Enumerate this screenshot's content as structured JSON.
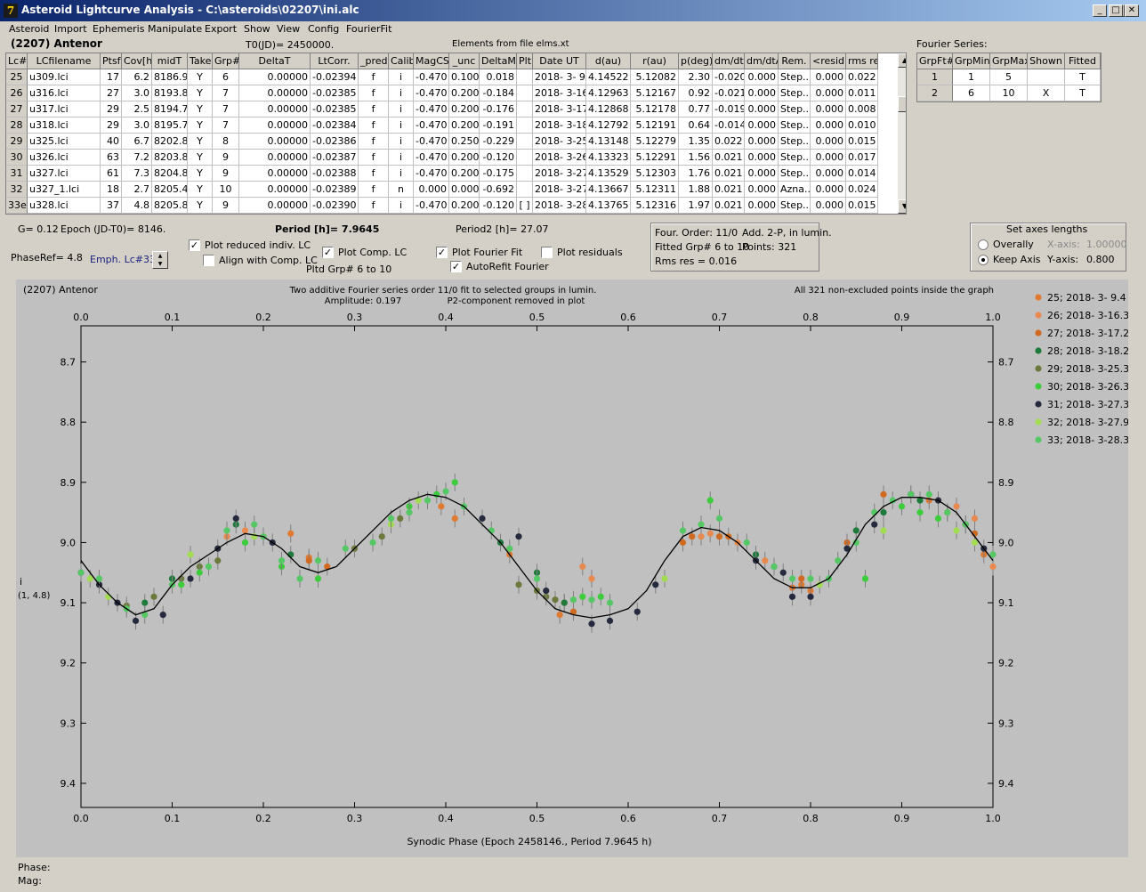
{
  "window": {
    "title": "Asteroid Lightcurve Analysis - C:\\asteroids\\02207\\ini.alc",
    "icon": "7"
  },
  "menu": [
    "Asteroid",
    "Import",
    "Ephemeris",
    "Manipulate",
    "Export",
    "Show",
    "View",
    "Config",
    "FourierFit"
  ],
  "header": {
    "asteroid": "(2207) Antenor",
    "t0": "T0(JD)= 2450000.",
    "elements": "Elements from file elms.xt",
    "fourier_series_label": "Fourier Series:"
  },
  "table": {
    "columns": [
      "Lc#",
      "LCfilename",
      "Ptsf",
      "Cov[h]",
      "midT",
      "Take",
      "Grp#",
      "DeltaT",
      "LtCorr.",
      "_pred.",
      "Calib.",
      "MagCS",
      "_unc",
      "DeltaM",
      "Plt",
      "Date UT",
      "d(au)",
      "r(au)",
      "p(deg)",
      "dm/dt",
      "dm/dtA",
      "Rem.",
      "<resid>",
      "rms res"
    ],
    "rows": [
      [
        "25",
        "u309.lci",
        "17",
        "6.2",
        "8186.9",
        "Y",
        "6",
        "0.00000",
        "-0.02394",
        "f",
        "i",
        "-0.470",
        "0.100",
        "0.018",
        "",
        "2018- 3- 9.4",
        "4.14522",
        "5.12082",
        "2.30",
        "-0.020",
        "0.000",
        "Step...",
        "0.000",
        "0.022"
      ],
      [
        "26",
        "u316.lci",
        "27",
        "3.0",
        "8193.8",
        "Y",
        "7",
        "0.00000",
        "-0.02385",
        "f",
        "i",
        "-0.470",
        "0.200",
        "-0.184",
        "",
        "2018- 3-16.3",
        "4.12963",
        "5.12167",
        "0.92",
        "-0.021",
        "0.000",
        "Step...",
        "0.000",
        "0.011"
      ],
      [
        "27",
        "u317.lci",
        "29",
        "2.5",
        "8194.7",
        "Y",
        "7",
        "0.00000",
        "-0.02385",
        "f",
        "i",
        "-0.470",
        "0.200",
        "-0.176",
        "",
        "2018- 3-17.2",
        "4.12868",
        "5.12178",
        "0.77",
        "-0.019",
        "0.000",
        "Step...",
        "0.000",
        "0.008"
      ],
      [
        "28",
        "u318.lci",
        "29",
        "3.0",
        "8195.7",
        "Y",
        "7",
        "0.00000",
        "-0.02384",
        "f",
        "i",
        "-0.470",
        "0.200",
        "-0.191",
        "",
        "2018- 3-18.2",
        "4.12792",
        "5.12191",
        "0.64",
        "-0.014",
        "0.000",
        "Step...",
        "0.000",
        "0.010"
      ],
      [
        "29",
        "u325.lci",
        "40",
        "6.7",
        "8202.8",
        "Y",
        "8",
        "0.00000",
        "-0.02386",
        "f",
        "i",
        "-0.470",
        "0.250",
        "-0.229",
        "",
        "2018- 3-25.3",
        "4.13148",
        "5.12279",
        "1.35",
        "0.022",
        "0.000",
        "Step...",
        "0.000",
        "0.015"
      ],
      [
        "30",
        "u326.lci",
        "63",
        "7.2",
        "8203.8",
        "Y",
        "9",
        "0.00000",
        "-0.02387",
        "f",
        "i",
        "-0.470",
        "0.200",
        "-0.120",
        "",
        "2018- 3-26.3",
        "4.13323",
        "5.12291",
        "1.56",
        "0.021",
        "0.000",
        "Step...",
        "0.000",
        "0.017"
      ],
      [
        "31",
        "u327.lci",
        "61",
        "7.3",
        "8204.8",
        "Y",
        "9",
        "0.00000",
        "-0.02388",
        "f",
        "i",
        "-0.470",
        "0.200",
        "-0.175",
        "",
        "2018- 3-27.3",
        "4.13529",
        "5.12303",
        "1.76",
        "0.021",
        "0.000",
        "Step...",
        "0.000",
        "0.014"
      ],
      [
        "32",
        "u327_1.lci",
        "18",
        "2.7",
        "8205.4",
        "Y",
        "10",
        "0.00000",
        "-0.02389",
        "f",
        "n",
        "0.000",
        "0.000",
        "-0.692",
        "",
        "2018- 3-27.9",
        "4.13667",
        "5.12311",
        "1.88",
        "0.021",
        "0.000",
        "Azna...",
        "0.000",
        "0.024"
      ],
      [
        "33e",
        "u328.lci",
        "37",
        "4.8",
        "8205.8",
        "Y",
        "9",
        "0.00000",
        "-0.02390",
        "f",
        "i",
        "-0.470",
        "0.200",
        "-0.120",
        "[ ]",
        "2018- 3-28.3",
        "4.13765",
        "5.12316",
        "1.97",
        "0.021",
        "0.000",
        "Step...",
        "0.000",
        "0.015"
      ]
    ]
  },
  "fourier_table": {
    "columns": [
      "GrpFt#",
      "GrpMin",
      "GrpMax",
      "Shown",
      "Fitted"
    ],
    "rows": [
      [
        "1",
        "1",
        "5",
        "",
        "T"
      ],
      [
        "2",
        "6",
        "10",
        "X",
        "T"
      ]
    ]
  },
  "controls": {
    "g": "G= 0.12",
    "epoch": "Epoch (JD-T0)= 8146.",
    "period": "Period [h]= 7.9645",
    "period2": "Period2 [h]= 27.07",
    "phaseref": "PhaseRef= 4.8",
    "emph": "Emph. Lc#33:",
    "plot_reduced": "Plot reduced indiv. LC",
    "align_comp": "Align with Comp. LC",
    "plot_comp": "Plot Comp. LC",
    "pltd_grp": "Pltd Grp#  6  to  10",
    "plot_fourier": "Plot Fourier Fit",
    "autorefit": "AutoRefit Fourier",
    "plot_residuals": "Plot residuals",
    "four_order": "Four. Order: 11/0",
    "add_2p": "Add. 2-P, in lumin.",
    "fitted_grp": "Fitted Grp# 6 to 10",
    "points": "Points: 321",
    "rms": "Rms res      = 0.016",
    "axes_title": "Set axes lengths",
    "overally": "Overally",
    "keep_axis": "Keep Axis",
    "xaxis_label": "X-axis:",
    "xaxis_val": "1.00000",
    "yaxis_label": "Y-axis:",
    "yaxis_val": "0.800"
  },
  "status": {
    "phase": "Phase:",
    "mag": "Mag:"
  },
  "chart_data": {
    "type": "scatter",
    "title": "Two additive Fourier series order 11/0 fit to selected groups in lumin.",
    "subtitle_amp": "Amplitude: 0.197",
    "subtitle_p2": "P2-component removed in plot",
    "object": "(2207) Antenor",
    "note_right": "All 321 non-excluded points inside the graph",
    "xlabel": "Synodic Phase (Epoch 2458146., Period 7.9645 h)",
    "ylabel": "i",
    "ylabel2": "(1, 4.8)",
    "xlim": [
      0,
      1.0
    ],
    "ylim": [
      8.64,
      9.44
    ],
    "y_inverted": true,
    "xticks": [
      "0.0",
      "0.1",
      "0.2",
      "0.3",
      "0.4",
      "0.5",
      "0.6",
      "0.7",
      "0.8",
      "0.9",
      "1.0"
    ],
    "yticks": [
      "8.7",
      "8.8",
      "8.9",
      "9.0",
      "9.1",
      "9.2",
      "9.3",
      "9.4"
    ],
    "grid": false,
    "legend_position": "right",
    "fit_curve": [
      [
        0.0,
        9.03
      ],
      [
        0.02,
        9.07
      ],
      [
        0.04,
        9.1
      ],
      [
        0.06,
        9.12
      ],
      [
        0.08,
        9.11
      ],
      [
        0.1,
        9.07
      ],
      [
        0.12,
        9.04
      ],
      [
        0.14,
        9.02
      ],
      [
        0.16,
        9.0
      ],
      [
        0.18,
        8.985
      ],
      [
        0.2,
        8.99
      ],
      [
        0.22,
        9.01
      ],
      [
        0.24,
        9.04
      ],
      [
        0.26,
        9.05
      ],
      [
        0.28,
        9.04
      ],
      [
        0.3,
        9.01
      ],
      [
        0.32,
        8.98
      ],
      [
        0.34,
        8.95
      ],
      [
        0.36,
        8.93
      ],
      [
        0.38,
        8.92
      ],
      [
        0.4,
        8.925
      ],
      [
        0.42,
        8.94
      ],
      [
        0.44,
        8.97
      ],
      [
        0.46,
        9.0
      ],
      [
        0.48,
        9.04
      ],
      [
        0.5,
        9.08
      ],
      [
        0.52,
        9.11
      ],
      [
        0.54,
        9.12
      ],
      [
        0.56,
        9.125
      ],
      [
        0.58,
        9.12
      ],
      [
        0.6,
        9.11
      ],
      [
        0.62,
        9.08
      ],
      [
        0.64,
        9.03
      ],
      [
        0.66,
        8.99
      ],
      [
        0.68,
        8.975
      ],
      [
        0.7,
        8.98
      ],
      [
        0.72,
        9.0
      ],
      [
        0.74,
        9.03
      ],
      [
        0.76,
        9.06
      ],
      [
        0.78,
        9.075
      ],
      [
        0.8,
        9.075
      ],
      [
        0.82,
        9.06
      ],
      [
        0.84,
        9.02
      ],
      [
        0.86,
        8.97
      ],
      [
        0.88,
        8.94
      ],
      [
        0.9,
        8.925
      ],
      [
        0.92,
        8.925
      ],
      [
        0.94,
        8.93
      ],
      [
        0.96,
        8.95
      ],
      [
        0.98,
        8.99
      ],
      [
        1.0,
        9.03
      ]
    ],
    "series": [
      {
        "name": "25; 2018- 3- 9.4",
        "color": "#e07a30",
        "points": [
          [
            0.23,
            8.985
          ],
          [
            0.25,
            9.025
          ],
          [
            0.395,
            8.94
          ],
          [
            0.41,
            8.96
          ],
          [
            0.47,
            9.02
          ],
          [
            0.525,
            9.12
          ],
          [
            0.78,
            9.075
          ],
          [
            0.79,
            9.07
          ],
          [
            0.8,
            9.08
          ],
          [
            0.93,
            8.93
          ],
          [
            0.95,
            8.95
          ],
          [
            0.99,
            9.02
          ]
        ]
      },
      {
        "name": "26; 2018- 3-16.3",
        "color": "#e88a50",
        "points": [
          [
            0.16,
            8.99
          ],
          [
            0.18,
            8.98
          ],
          [
            0.2,
            8.99
          ],
          [
            0.55,
            9.04
          ],
          [
            0.56,
            9.06
          ],
          [
            0.68,
            8.99
          ],
          [
            0.69,
            8.985
          ],
          [
            0.72,
            9.0
          ],
          [
            0.75,
            9.03
          ],
          [
            0.96,
            8.94
          ],
          [
            0.98,
            8.96
          ],
          [
            1.0,
            9.04
          ]
        ]
      },
      {
        "name": "27; 2018- 3-17.2",
        "color": "#d06a20",
        "points": [
          [
            0.25,
            9.03
          ],
          [
            0.27,
            9.04
          ],
          [
            0.53,
            9.1
          ],
          [
            0.54,
            9.115
          ],
          [
            0.66,
            9.0
          ],
          [
            0.67,
            8.99
          ],
          [
            0.7,
            8.99
          ],
          [
            0.71,
            8.99
          ],
          [
            0.79,
            9.06
          ],
          [
            0.84,
            9.0
          ],
          [
            0.88,
            8.92
          ],
          [
            0.98,
            8.985
          ]
        ]
      },
      {
        "name": "28; 2018- 3-18.2",
        "color": "#1e7a3a",
        "points": [
          [
            0.07,
            9.1
          ],
          [
            0.1,
            9.06
          ],
          [
            0.17,
            8.97
          ],
          [
            0.23,
            9.02
          ],
          [
            0.46,
            9.0
          ],
          [
            0.5,
            9.05
          ],
          [
            0.53,
            9.1
          ],
          [
            0.74,
            9.02
          ],
          [
            0.76,
            9.04
          ],
          [
            0.85,
            8.98
          ],
          [
            0.88,
            8.95
          ],
          [
            0.92,
            8.93
          ]
        ]
      },
      {
        "name": "29; 2018- 3-25.3",
        "color": "#6b7a3c",
        "points": [
          [
            0.05,
            9.105
          ],
          [
            0.08,
            9.09
          ],
          [
            0.11,
            9.06
          ],
          [
            0.13,
            9.04
          ],
          [
            0.15,
            9.03
          ],
          [
            0.3,
            9.01
          ],
          [
            0.33,
            8.99
          ],
          [
            0.35,
            8.96
          ],
          [
            0.48,
            9.07
          ],
          [
            0.5,
            9.08
          ],
          [
            0.51,
            9.09
          ],
          [
            0.52,
            9.095
          ]
        ]
      },
      {
        "name": "30; 2018- 3-26.3",
        "color": "#3ccc3c",
        "points": [
          [
            0.11,
            9.07
          ],
          [
            0.13,
            9.05
          ],
          [
            0.18,
            9.0
          ],
          [
            0.22,
            9.04
          ],
          [
            0.26,
            9.06
          ],
          [
            0.36,
            8.94
          ],
          [
            0.39,
            8.92
          ],
          [
            0.41,
            8.9
          ],
          [
            0.55,
            9.09
          ],
          [
            0.57,
            9.09
          ],
          [
            0.69,
            8.93
          ],
          [
            0.86,
            9.06
          ],
          [
            0.9,
            8.94
          ],
          [
            0.92,
            8.95
          ],
          [
            0.94,
            8.96
          ]
        ]
      },
      {
        "name": "31; 2018- 3-27.3",
        "color": "#252a3e",
        "points": [
          [
            0.0,
            9.05
          ],
          [
            0.02,
            9.07
          ],
          [
            0.04,
            9.1
          ],
          [
            0.06,
            9.13
          ],
          [
            0.09,
            9.12
          ],
          [
            0.12,
            9.06
          ],
          [
            0.15,
            9.01
          ],
          [
            0.17,
            8.96
          ],
          [
            0.21,
            9.0
          ],
          [
            0.44,
            8.96
          ],
          [
            0.48,
            8.99
          ],
          [
            0.51,
            9.08
          ],
          [
            0.56,
            9.135
          ],
          [
            0.58,
            9.13
          ],
          [
            0.61,
            9.115
          ],
          [
            0.63,
            9.07
          ],
          [
            0.74,
            9.03
          ],
          [
            0.77,
            9.05
          ],
          [
            0.78,
            9.09
          ],
          [
            0.8,
            9.09
          ],
          [
            0.84,
            9.01
          ],
          [
            0.87,
            8.97
          ],
          [
            0.91,
            8.92
          ],
          [
            0.94,
            8.93
          ],
          [
            0.97,
            8.97
          ],
          [
            0.99,
            9.01
          ]
        ]
      },
      {
        "name": "32; 2018- 3-27.9",
        "color": "#a2dc52",
        "points": [
          [
            0.01,
            9.06
          ],
          [
            0.03,
            9.09
          ],
          [
            0.12,
            9.02
          ],
          [
            0.14,
            9.04
          ],
          [
            0.19,
            8.99
          ],
          [
            0.34,
            8.97
          ],
          [
            0.37,
            8.93
          ],
          [
            0.64,
            9.06
          ],
          [
            0.81,
            9.07
          ],
          [
            0.88,
            8.98
          ],
          [
            0.96,
            8.98
          ],
          [
            0.98,
            9.0
          ]
        ]
      },
      {
        "name": "33; 2018- 3-28.3",
        "color": "#55c865",
        "points": [
          [
            0.0,
            9.05
          ],
          [
            0.02,
            9.06
          ],
          [
            0.05,
            9.11
          ],
          [
            0.07,
            9.12
          ],
          [
            0.1,
            9.07
          ],
          [
            0.14,
            9.04
          ],
          [
            0.16,
            8.98
          ],
          [
            0.19,
            8.97
          ],
          [
            0.2,
            8.99
          ],
          [
            0.22,
            9.03
          ],
          [
            0.24,
            9.06
          ],
          [
            0.26,
            9.03
          ],
          [
            0.29,
            9.01
          ],
          [
            0.32,
            9.0
          ],
          [
            0.34,
            8.96
          ],
          [
            0.36,
            8.95
          ],
          [
            0.38,
            8.93
          ],
          [
            0.4,
            8.915
          ],
          [
            0.42,
            8.94
          ],
          [
            0.45,
            8.98
          ],
          [
            0.47,
            9.01
          ],
          [
            0.5,
            9.06
          ],
          [
            0.54,
            9.095
          ],
          [
            0.56,
            9.095
          ],
          [
            0.58,
            9.1
          ],
          [
            0.66,
            8.98
          ],
          [
            0.68,
            8.97
          ],
          [
            0.7,
            8.96
          ],
          [
            0.73,
            9.0
          ],
          [
            0.76,
            9.04
          ],
          [
            0.78,
            9.06
          ],
          [
            0.8,
            9.06
          ],
          [
            0.82,
            9.06
          ],
          [
            0.83,
            9.03
          ],
          [
            0.85,
            9.0
          ],
          [
            0.87,
            8.95
          ],
          [
            0.89,
            8.93
          ],
          [
            0.91,
            8.92
          ],
          [
            0.93,
            8.92
          ],
          [
            0.95,
            8.95
          ],
          [
            0.97,
            8.97
          ],
          [
            1.0,
            9.02
          ]
        ]
      }
    ]
  }
}
